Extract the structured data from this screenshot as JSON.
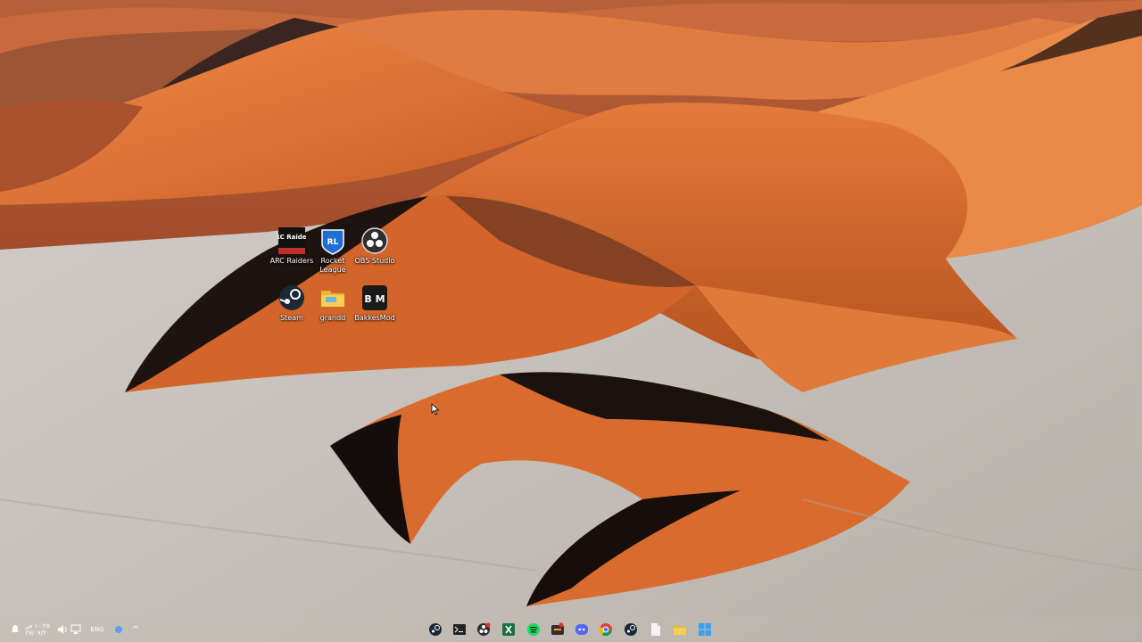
{
  "desktop": {
    "icons": [
      {
        "id": "arc-raiders",
        "label": "ARC Raiders",
        "glyph": "ARC Raiders"
      },
      {
        "id": "rocket-league",
        "label": "Rocket League",
        "glyph": "RL"
      },
      {
        "id": "obs-studio",
        "label": "OBS Studio"
      },
      {
        "id": "steam",
        "label": "Steam"
      },
      {
        "id": "grandd",
        "label": "grandd"
      },
      {
        "id": "bakkesmod",
        "label": "BakkesMod",
        "glyph": "B M"
      }
    ]
  },
  "taskbar": {
    "tray": {
      "clock_time": "١٠:٢٥ ص",
      "clock_date": "٢٧/٠٧/٢٠",
      "language": "ENG",
      "chevron": "^"
    },
    "apps": [
      "steam-icon",
      "terminal-icon",
      "obs-icon",
      "excel-icon",
      "spotify-icon",
      "app-icon",
      "discord-icon",
      "chrome-icon",
      "steam-icon",
      "file-icon",
      "folder-icon",
      "start-icon"
    ]
  },
  "colors": {
    "dune_light": "#e3763a",
    "dune_mid": "#c75a24",
    "dune_shadow": "#2b1a14",
    "pan": "#c9c4bd",
    "taskbar": "#c7bcb4"
  }
}
